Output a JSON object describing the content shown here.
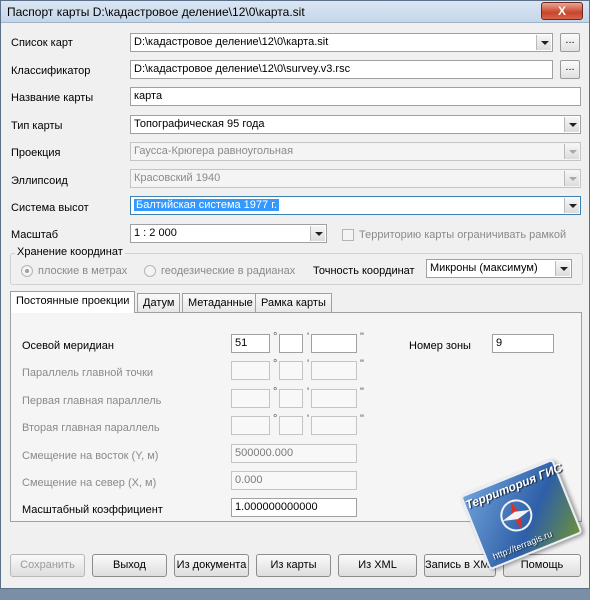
{
  "window": {
    "title": "Паспорт карты  D:\\кадастровое деление\\12\\0\\карта.sit",
    "close_label": "X"
  },
  "fields": {
    "map_list": {
      "label": "Список карт",
      "value": "D:\\кадастровое деление\\12\\0\\карта.sit",
      "browse": "..."
    },
    "classifier": {
      "label": "Классификатор",
      "value": "D:\\кадастровое деление\\12\\0\\survey.v3.rsc",
      "browse": "..."
    },
    "map_name": {
      "label": "Название карты",
      "value": "карта"
    },
    "map_type": {
      "label": "Тип карты",
      "value": "Топографическая 95 года"
    },
    "projection": {
      "label": "Проекция",
      "value": "Гаусса-Крюгера равноугольная"
    },
    "ellipsoid": {
      "label": "Эллипсоид",
      "value": "Красовский 1940"
    },
    "height_system": {
      "label": "Система высот",
      "value": "Балтийская система 1977 г."
    },
    "scale": {
      "label": "Масштаб",
      "value": "1 : 2 000"
    },
    "limit_frame": {
      "label": "Территорию карты ограничивать рамкой",
      "checked": false
    }
  },
  "storage": {
    "group_label": "Хранение координат",
    "flat_label": "плоские в метрах",
    "geodetic_label": "геодезические в радианах",
    "precision_label": "Точность координат",
    "precision_value": "Микроны (максимум)"
  },
  "tabs": [
    {
      "label": "Постоянные проекции",
      "active": true
    },
    {
      "label": "Датум",
      "active": false
    },
    {
      "label": "Метаданные",
      "active": false
    },
    {
      "label": "Рамка карты",
      "active": false
    }
  ],
  "projection_params": {
    "central_meridian": {
      "label": "Осевой меридиан",
      "deg": "51",
      "min": "",
      "sec": ""
    },
    "zone": {
      "label": "Номер зоны",
      "value": "9"
    },
    "main_point_parallel": {
      "label": "Параллель главной точки"
    },
    "first_parallel": {
      "label": "Первая главная параллель"
    },
    "second_parallel": {
      "label": "Вторая главная параллель"
    },
    "false_easting": {
      "label": "Смещение на восток (Y, м)",
      "value": "500000.000"
    },
    "false_northing": {
      "label": "Смещение на север (X, м)",
      "value": "0.000"
    },
    "scale_factor": {
      "label": "Масштабный коэффициент",
      "value": "1.000000000000"
    },
    "deg_mark": "°",
    "min_mark": "'",
    "sec_mark": "\""
  },
  "buttons": {
    "save": "Сохранить",
    "exit": "Выход",
    "from_document": "Из документа",
    "from_map": "Из карты",
    "from_xml": "Из XML",
    "write_xml": "Запись в XML",
    "help": "Помощь"
  },
  "watermark": {
    "title": "Территория ГИС",
    "url": "http://terragis.ru"
  }
}
